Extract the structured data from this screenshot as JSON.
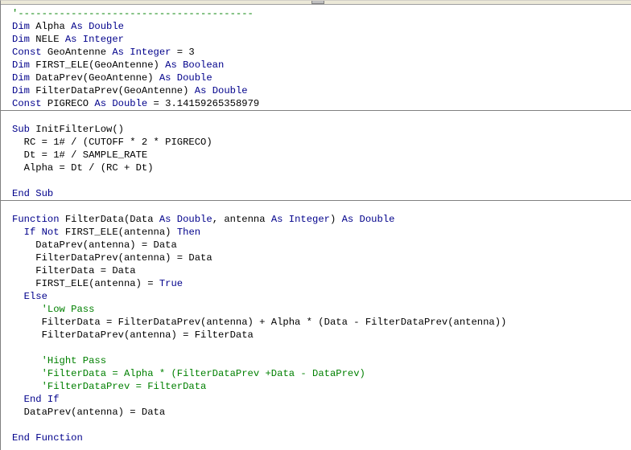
{
  "colors": {
    "keyword": "#00008b",
    "comment": "#008000",
    "text": "#000000",
    "separator": "#808080",
    "background": "#ffffff"
  },
  "code": {
    "lines": [
      {
        "sep": false,
        "tokens": [
          {
            "t": "c",
            "v": "'----------------------------------------"
          }
        ]
      },
      {
        "sep": false,
        "tokens": [
          {
            "t": "k",
            "v": "Dim"
          },
          {
            "t": "n",
            "v": " Alpha "
          },
          {
            "t": "k",
            "v": "As Double"
          }
        ]
      },
      {
        "sep": false,
        "tokens": [
          {
            "t": "k",
            "v": "Dim"
          },
          {
            "t": "n",
            "v": " NELE "
          },
          {
            "t": "k",
            "v": "As Integer"
          }
        ]
      },
      {
        "sep": false,
        "tokens": [
          {
            "t": "k",
            "v": "Const"
          },
          {
            "t": "n",
            "v": " GeoAntenne "
          },
          {
            "t": "k",
            "v": "As Integer"
          },
          {
            "t": "n",
            "v": " = 3"
          }
        ]
      },
      {
        "sep": false,
        "tokens": [
          {
            "t": "k",
            "v": "Dim"
          },
          {
            "t": "n",
            "v": " FIRST_ELE(GeoAntenne) "
          },
          {
            "t": "k",
            "v": "As Boolean"
          }
        ]
      },
      {
        "sep": false,
        "tokens": [
          {
            "t": "k",
            "v": "Dim"
          },
          {
            "t": "n",
            "v": " DataPrev(GeoAntenne) "
          },
          {
            "t": "k",
            "v": "As Double"
          }
        ]
      },
      {
        "sep": false,
        "tokens": [
          {
            "t": "k",
            "v": "Dim"
          },
          {
            "t": "n",
            "v": " FilterDataPrev(GeoAntenne) "
          },
          {
            "t": "k",
            "v": "As Double"
          }
        ]
      },
      {
        "sep": true,
        "tokens": [
          {
            "t": "k",
            "v": "Const"
          },
          {
            "t": "n",
            "v": " PIGRECO "
          },
          {
            "t": "k",
            "v": "As Double"
          },
          {
            "t": "n",
            "v": " = 3.14159265358979"
          }
        ]
      },
      {
        "sep": false,
        "tokens": []
      },
      {
        "sep": false,
        "tokens": [
          {
            "t": "k",
            "v": "Sub"
          },
          {
            "t": "n",
            "v": " InitFilterLow()"
          }
        ]
      },
      {
        "sep": false,
        "tokens": [
          {
            "t": "n",
            "v": "  RC = 1# / (CUTOFF * 2 * PIGRECO)"
          }
        ]
      },
      {
        "sep": false,
        "tokens": [
          {
            "t": "n",
            "v": "  Dt = 1# / SAMPLE_RATE"
          }
        ]
      },
      {
        "sep": false,
        "tokens": [
          {
            "t": "n",
            "v": "  Alpha = Dt / (RC + Dt)"
          }
        ]
      },
      {
        "sep": false,
        "tokens": []
      },
      {
        "sep": true,
        "tokens": [
          {
            "t": "k",
            "v": "End Sub"
          }
        ]
      },
      {
        "sep": false,
        "tokens": []
      },
      {
        "sep": false,
        "tokens": [
          {
            "t": "k",
            "v": "Function"
          },
          {
            "t": "n",
            "v": " FilterData(Data "
          },
          {
            "t": "k",
            "v": "As Double"
          },
          {
            "t": "n",
            "v": ", antenna "
          },
          {
            "t": "k",
            "v": "As Integer"
          },
          {
            "t": "n",
            "v": ") "
          },
          {
            "t": "k",
            "v": "As Double"
          }
        ]
      },
      {
        "sep": false,
        "tokens": [
          {
            "t": "n",
            "v": "  "
          },
          {
            "t": "k",
            "v": "If Not"
          },
          {
            "t": "n",
            "v": " FIRST_ELE(antenna) "
          },
          {
            "t": "k",
            "v": "Then"
          }
        ]
      },
      {
        "sep": false,
        "tokens": [
          {
            "t": "n",
            "v": "    DataPrev(antenna) = Data"
          }
        ]
      },
      {
        "sep": false,
        "tokens": [
          {
            "t": "n",
            "v": "    FilterDataPrev(antenna) = Data"
          }
        ]
      },
      {
        "sep": false,
        "tokens": [
          {
            "t": "n",
            "v": "    FilterData = Data"
          }
        ]
      },
      {
        "sep": false,
        "tokens": [
          {
            "t": "n",
            "v": "    FIRST_ELE(antenna) = "
          },
          {
            "t": "k",
            "v": "True"
          }
        ]
      },
      {
        "sep": false,
        "tokens": [
          {
            "t": "n",
            "v": "  "
          },
          {
            "t": "k",
            "v": "Else"
          }
        ]
      },
      {
        "sep": false,
        "tokens": [
          {
            "t": "n",
            "v": "     "
          },
          {
            "t": "c",
            "v": "'Low Pass"
          }
        ]
      },
      {
        "sep": false,
        "tokens": [
          {
            "t": "n",
            "v": "     FilterData = FilterDataPrev(antenna) + Alpha * (Data - FilterDataPrev(antenna))"
          }
        ]
      },
      {
        "sep": false,
        "tokens": [
          {
            "t": "n",
            "v": "     FilterDataPrev(antenna) = FilterData"
          }
        ]
      },
      {
        "sep": false,
        "tokens": []
      },
      {
        "sep": false,
        "tokens": [
          {
            "t": "n",
            "v": "     "
          },
          {
            "t": "c",
            "v": "'Hight Pass"
          }
        ]
      },
      {
        "sep": false,
        "tokens": [
          {
            "t": "n",
            "v": "     "
          },
          {
            "t": "c",
            "v": "'FilterData = Alpha * (FilterDataPrev +Data - DataPrev)"
          }
        ]
      },
      {
        "sep": false,
        "tokens": [
          {
            "t": "n",
            "v": "     "
          },
          {
            "t": "c",
            "v": "'FilterDataPrev = FilterData"
          }
        ]
      },
      {
        "sep": false,
        "tokens": [
          {
            "t": "n",
            "v": "  "
          },
          {
            "t": "k",
            "v": "End If"
          }
        ]
      },
      {
        "sep": false,
        "tokens": [
          {
            "t": "n",
            "v": "  DataPrev(antenna) = Data"
          }
        ]
      },
      {
        "sep": false,
        "tokens": []
      },
      {
        "sep": false,
        "tokens": [
          {
            "t": "k",
            "v": "End Function"
          }
        ]
      }
    ]
  }
}
